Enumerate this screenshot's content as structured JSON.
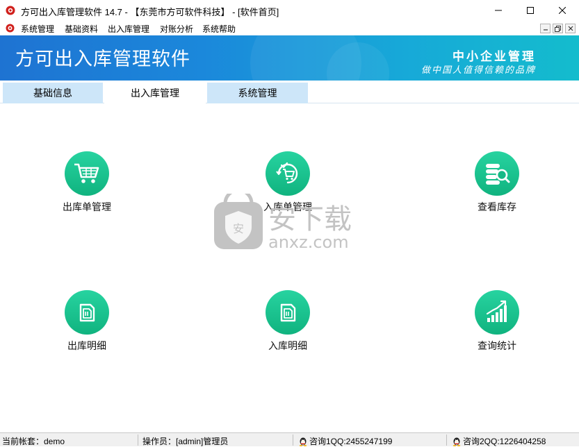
{
  "window": {
    "title": "方可出入库管理软件 14.7 - 【东莞市方可软件科技】 - [软件首页]"
  },
  "menu": [
    "系统管理",
    "基础资料",
    "出入库管理",
    "对账分析",
    "系统帮助"
  ],
  "banner": {
    "brand": "方可出入库管理软件",
    "slogan_line1": "中小企业管理",
    "slogan_line2": "做中国人值得信赖的品牌"
  },
  "tabs": [
    {
      "label": "基础信息",
      "active": false
    },
    {
      "label": "出入库管理",
      "active": true
    },
    {
      "label": "系统管理",
      "active": false
    }
  ],
  "tiles": [
    {
      "label": "出库单管理",
      "icon": "shopping-cart-icon"
    },
    {
      "label": "入库单管理",
      "icon": "cart-check-icon"
    },
    {
      "label": "查看库存",
      "icon": "stock-search-icon"
    },
    {
      "label": "出库明细",
      "icon": "document-copy-icon"
    },
    {
      "label": "入库明细",
      "icon": "document-copy-icon"
    },
    {
      "label": "查询统计",
      "icon": "bar-chart-icon"
    }
  ],
  "watermark": {
    "cn": "安下载",
    "en": "anxz.com",
    "badge": "安"
  },
  "status": {
    "account": "当前帐套：demo",
    "operator": "操作员：[admin]管理员",
    "qq1": "咨询1QQ:2455247199",
    "qq2": "咨询2QQ:1226404258"
  },
  "colors": {
    "banner_start": "#1e73d2",
    "banner_end": "#14bccd",
    "tile_green": "#1bc28e",
    "tab_inactive": "#cde6f9"
  }
}
